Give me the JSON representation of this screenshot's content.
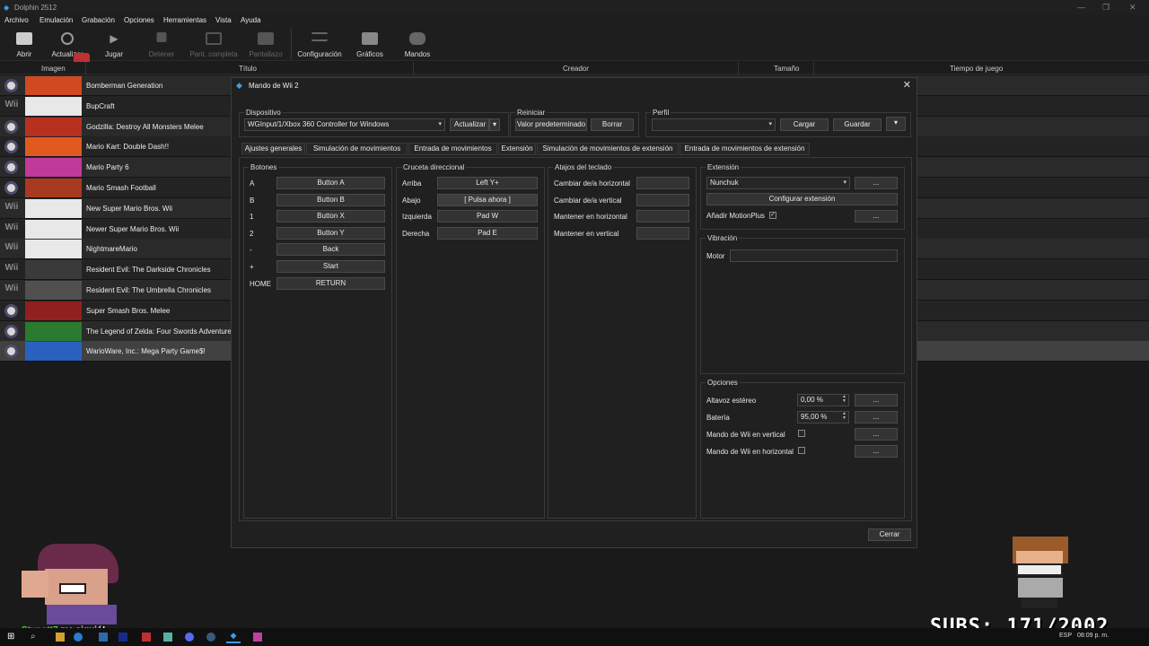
{
  "window": {
    "title": "Dolphin 2512"
  },
  "menu": [
    "Archivo",
    "Emulación",
    "Grabación",
    "Opciones",
    "Herramientas",
    "Vista",
    "Ayuda"
  ],
  "toolbar": {
    "open": "Abrir",
    "refresh": "Actualizar",
    "play": "Jugar",
    "stop": "Detener",
    "fullscreen": "Pant. completa",
    "screenshot": "Pantallazo",
    "config": "Configuración",
    "graphics": "Gráficos",
    "controllers": "Mandos"
  },
  "columns": {
    "image": "Imagen",
    "title": "Título",
    "creator": "Creador",
    "size": "Tamaño",
    "playtime": "Tiempo de juego"
  },
  "games": [
    {
      "platform": "gc",
      "title": "Bomberman Generation",
      "cover_color": "#d04a20"
    },
    {
      "platform": "Wii",
      "title": "BupCraft",
      "cover_color": "#e8e8e8"
    },
    {
      "platform": "gc",
      "title": "Godzilla: Destroy All Monsters Melee",
      "cover_color": "#b83020"
    },
    {
      "platform": "gc",
      "title": "Mario Kart: Double Dash!!",
      "cover_color": "#e05a20"
    },
    {
      "platform": "gc",
      "title": "Mario Party 6",
      "cover_color": "#c03a9a"
    },
    {
      "platform": "gc",
      "title": "Mario Smash Football",
      "cover_color": "#a83a20"
    },
    {
      "platform": "Wii",
      "title": "New Super Mario Bros. Wii",
      "cover_color": "#e8e8e8"
    },
    {
      "platform": "Wii",
      "title": "Newer Super Mario Bros. Wii",
      "cover_color": "#e8e8e8"
    },
    {
      "platform": "Wii",
      "title": "NightmareMario",
      "cover_color": "#e8e8e8"
    },
    {
      "platform": "Wii",
      "title": "Resident Evil: The Darkside Chronicles",
      "cover_color": "#3a3a3a"
    },
    {
      "platform": "Wii",
      "title": "Resident Evil: The Umbrella Chronicles",
      "cover_color": "#505050"
    },
    {
      "platform": "gc",
      "title": "Super Smash Bros. Melee",
      "cover_color": "#902020"
    },
    {
      "platform": "gc",
      "title": "The Legend of Zelda: Four Swords Adventures",
      "cover_color": "#2a7a30"
    },
    {
      "platform": "gc",
      "title": "WarioWare, Inc.: Mega Party Game$!",
      "cover_color": "#2a60c0"
    }
  ],
  "dialog": {
    "title": "Mando de Wii 2",
    "device": {
      "label": "Dispositivo",
      "value": "WGInput/1/Xbox 360 Controller for Windows",
      "refresh": "Actualizar"
    },
    "reset": {
      "label": "Reiniciar",
      "default": "Valor predeterminado",
      "clear": "Borrar"
    },
    "profile": {
      "label": "Perfil",
      "load": "Cargar",
      "save": "Guardar"
    },
    "tabs": [
      "Ajustes generales",
      "Simulación de movimientos",
      "Entrada de movimientos",
      "Extensión",
      "Simulación de movimientos de extensión",
      "Entrada de movimientos de extensión"
    ],
    "buttons": {
      "label": "Botones",
      "rows": [
        {
          "key": "A",
          "value": "Button A"
        },
        {
          "key": "B",
          "value": "Button B"
        },
        {
          "key": "1",
          "value": "Button X"
        },
        {
          "key": "2",
          "value": "Button Y"
        },
        {
          "key": "-",
          "value": "Back"
        },
        {
          "key": "+",
          "value": "Start"
        },
        {
          "key": "HOME",
          "value": "RETURN"
        }
      ]
    },
    "dpad": {
      "label": "Cruceta direccional",
      "rows": [
        {
          "key": "Arriba",
          "value": "Left Y+"
        },
        {
          "key": "Abajo",
          "value": "[ Pulsa ahora ]"
        },
        {
          "key": "Izquierda",
          "value": "Pad W"
        },
        {
          "key": "Derecha",
          "value": "Pad E"
        }
      ]
    },
    "hotkeys": {
      "label": "Atajos del teclado",
      "rows": [
        {
          "key": "Cambiar de/a horizontal",
          "value": ""
        },
        {
          "key": "Cambiar de/a vertical",
          "value": ""
        },
        {
          "key": "Mantener en horizontal",
          "value": ""
        },
        {
          "key": "Mantener en vertical",
          "value": ""
        }
      ]
    },
    "extension": {
      "label": "Extensión",
      "value": "Nunchuk",
      "more": "...",
      "configure": "Configurar extensión",
      "motionplus": "Añadir MotionPlus"
    },
    "rumble": {
      "label": "Vibración",
      "motor": "Motor"
    },
    "options": {
      "label": "Opciones",
      "speaker": "Altavoz estéreo",
      "speaker_value": "0,00 %",
      "battery": "Batería",
      "battery_value": "95,00 %",
      "upright": "Mando de Wii en vertical",
      "sideways": "Mando de Wii en horizontal",
      "more": "..."
    },
    "close": "Cerrar"
  },
  "overlay": {
    "subs": "SUBS: 171/2002",
    "chat_user": "Stupott7",
    "chat_msg": " me siguió!"
  },
  "taskbar": {
    "lang": "ESP",
    "time": "08:09 p. m."
  }
}
